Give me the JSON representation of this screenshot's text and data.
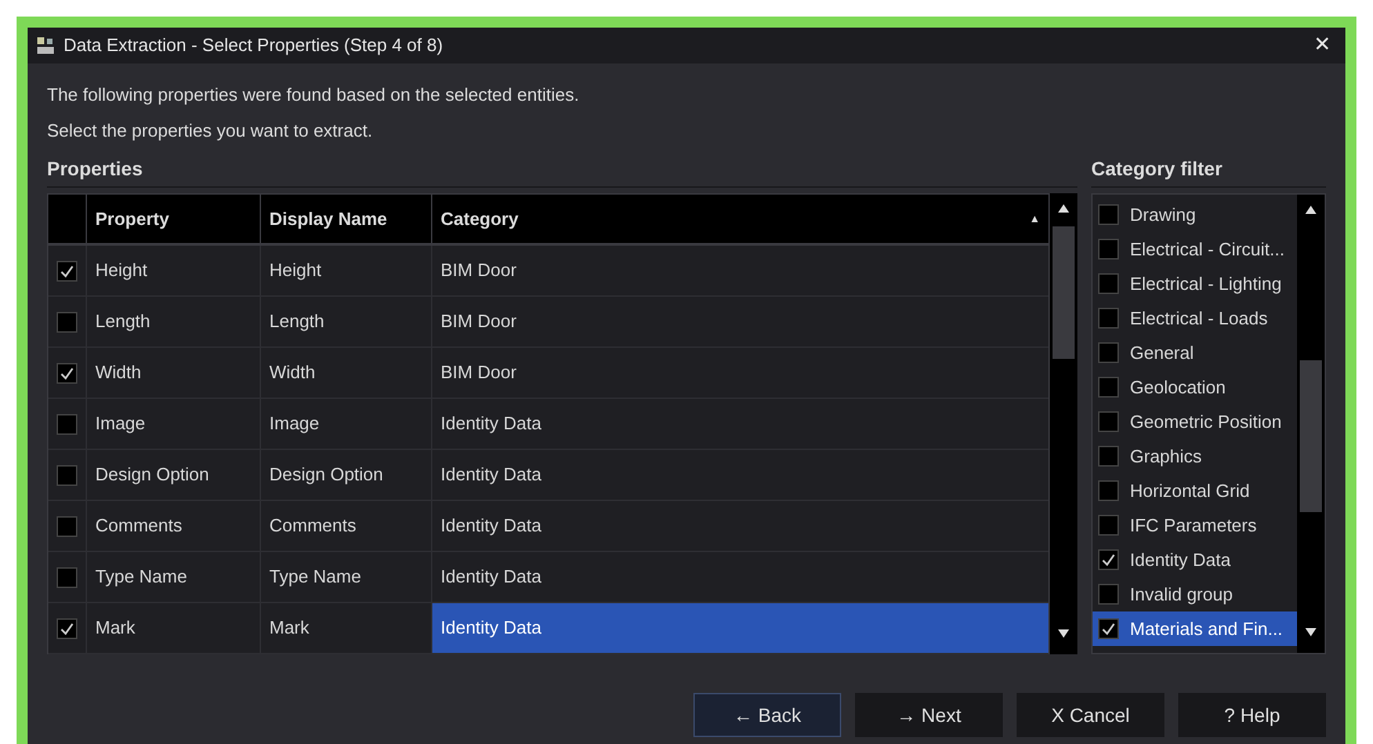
{
  "window": {
    "title": "Data Extraction - Select Properties (Step 4 of 8)",
    "close": "✕"
  },
  "intro": [
    "The following properties were found based on the selected entities.",
    "Select the properties you want to extract."
  ],
  "properties": {
    "heading": "Properties",
    "columns": [
      "Property",
      "Display Name",
      "Category"
    ],
    "sort_indicator": "▲",
    "rows": [
      {
        "checked": true,
        "selected": false,
        "property": "Height",
        "display_name": "Height",
        "category": "BIM Door"
      },
      {
        "checked": false,
        "selected": false,
        "property": "Length",
        "display_name": "Length",
        "category": "BIM Door"
      },
      {
        "checked": true,
        "selected": false,
        "property": "Width",
        "display_name": "Width",
        "category": "BIM Door"
      },
      {
        "checked": false,
        "selected": false,
        "property": "Image",
        "display_name": "Image",
        "category": "Identity Data"
      },
      {
        "checked": false,
        "selected": false,
        "property": "Design Option",
        "display_name": "Design Option",
        "category": "Identity Data"
      },
      {
        "checked": false,
        "selected": false,
        "property": "Comments",
        "display_name": "Comments",
        "category": "Identity Data"
      },
      {
        "checked": false,
        "selected": false,
        "property": "Type Name",
        "display_name": "Type Name",
        "category": "Identity Data"
      },
      {
        "checked": true,
        "selected": true,
        "property": "Mark",
        "display_name": "Mark",
        "category": "Identity Data"
      }
    ]
  },
  "category_filter": {
    "heading": "Category filter",
    "items": [
      {
        "label": "Drawing",
        "checked": false,
        "selected": false
      },
      {
        "label": "Electrical - Circuit...",
        "checked": false,
        "selected": false
      },
      {
        "label": "Electrical - Lighting",
        "checked": false,
        "selected": false
      },
      {
        "label": "Electrical - Loads",
        "checked": false,
        "selected": false
      },
      {
        "label": "General",
        "checked": false,
        "selected": false
      },
      {
        "label": "Geolocation",
        "checked": false,
        "selected": false
      },
      {
        "label": "Geometric Position",
        "checked": false,
        "selected": false
      },
      {
        "label": "Graphics",
        "checked": false,
        "selected": false
      },
      {
        "label": "Horizontal Grid",
        "checked": false,
        "selected": false
      },
      {
        "label": "IFC Parameters",
        "checked": false,
        "selected": false
      },
      {
        "label": "Identity Data",
        "checked": true,
        "selected": false
      },
      {
        "label": "Invalid group",
        "checked": false,
        "selected": false
      },
      {
        "label": "Materials and Fin...",
        "checked": true,
        "selected": true
      }
    ]
  },
  "buttons": [
    "← Back",
    "→ Next",
    "X Cancel",
    "? Help"
  ]
}
